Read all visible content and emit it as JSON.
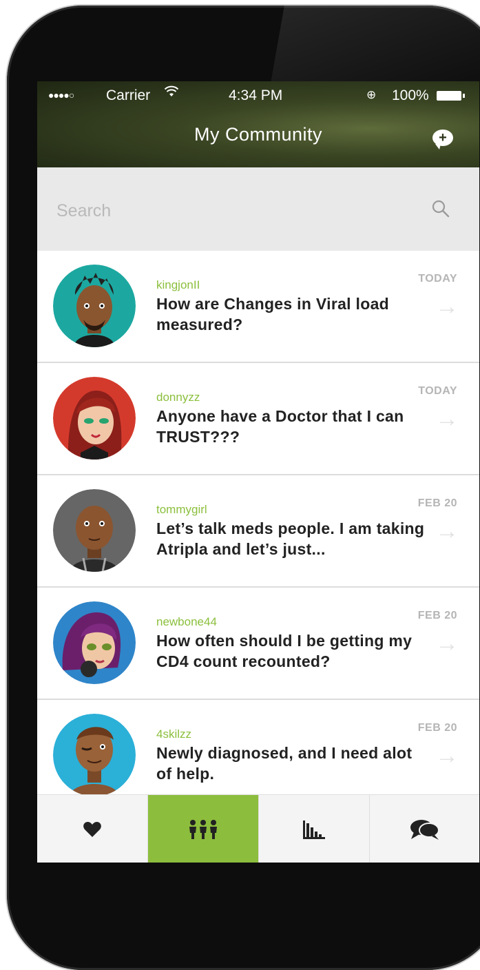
{
  "status_bar": {
    "signal": "●●●●○",
    "carrier": "Carrier",
    "time": "4:34 PM",
    "battery": "100%"
  },
  "header": {
    "title": "My Community"
  },
  "search": {
    "placeholder": "Search"
  },
  "posts": [
    {
      "username": "kingjonII",
      "date": "TODAY",
      "message": "How are Changes in Viral load measured?",
      "avatar": "avatar-man-dark-hair",
      "avatar_bg": "#1ca8a0"
    },
    {
      "username": "donnyzz",
      "date": "TODAY",
      "message": "Anyone have a Doctor that I can TRUST???",
      "avatar": "avatar-woman-red-hair",
      "avatar_bg": "#d43a2c"
    },
    {
      "username": "tommygirl",
      "date": "FEB 20",
      "message": "Let’s talk meds people. I am taking Atripla  and let’s just...",
      "avatar": "avatar-bald-man",
      "avatar_bg": "#666666"
    },
    {
      "username": "newbone44",
      "date": "FEB 20",
      "message": "How often should I be getting my CD4 count recounted?",
      "avatar": "avatar-woman-purple-hair",
      "avatar_bg": "#2f85c9"
    },
    {
      "username": "4skilzz",
      "date": "FEB 20",
      "message": "Newly diagnosed, and I need alot of help.",
      "avatar": "avatar-winking-man",
      "avatar_bg": "#2bb0d8"
    }
  ],
  "tabs": [
    {
      "name": "favorites",
      "icon": "heart-icon",
      "active": false
    },
    {
      "name": "community",
      "icon": "people-icon",
      "active": true
    },
    {
      "name": "stats",
      "icon": "bar-chart-icon",
      "active": false
    },
    {
      "name": "messages",
      "icon": "chat-bubbles-icon",
      "active": false
    }
  ],
  "colors": {
    "accent": "#8dbd3d",
    "header_bg": "#2b3318",
    "username": "#8bbf3c"
  }
}
